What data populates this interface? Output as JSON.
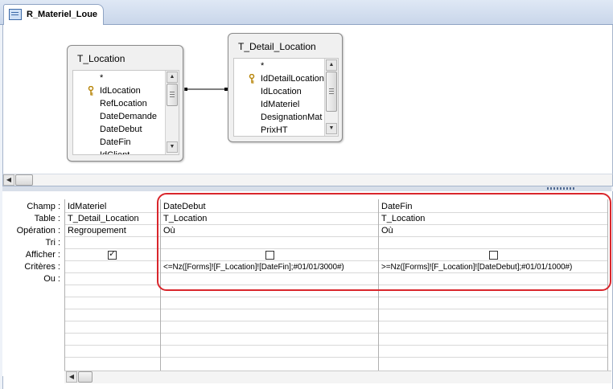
{
  "tab": {
    "label": "R_Materiel_Loue",
    "icon": "query-icon"
  },
  "tables": [
    {
      "title": "T_Location",
      "fields": [
        {
          "name": "*",
          "key": false
        },
        {
          "name": "IdLocation",
          "key": true
        },
        {
          "name": "RefLocation",
          "key": false
        },
        {
          "name": "DateDemande",
          "key": false
        },
        {
          "name": "DateDebut",
          "key": false
        },
        {
          "name": "DateFin",
          "key": false
        },
        {
          "name": "IdClient",
          "key": false
        }
      ]
    },
    {
      "title": "T_Detail_Location",
      "fields": [
        {
          "name": "*",
          "key": false
        },
        {
          "name": "IdDetailLocation",
          "key": true
        },
        {
          "name": "IdLocation",
          "key": false
        },
        {
          "name": "IdMateriel",
          "key": false
        },
        {
          "name": "DesignationMat",
          "key": false
        },
        {
          "name": "PrixHT",
          "key": false
        }
      ]
    }
  ],
  "grid": {
    "row_labels": [
      "Champ :",
      "Table :",
      "Opération :",
      "Tri :",
      "Afficher :",
      "Critères :",
      "Ou :"
    ],
    "columns": [
      {
        "champ": "IdMateriel",
        "table": "T_Detail_Location",
        "operation": "Regroupement",
        "tri": "",
        "afficher": true,
        "criteres": "",
        "ou": ""
      },
      {
        "champ": "DateDebut",
        "table": "T_Location",
        "operation": "Où",
        "tri": "",
        "afficher": false,
        "criteres": "<=Nz([Forms]![F_Location]![DateFin];#01/01/3000#)",
        "ou": ""
      },
      {
        "champ": "DateFin",
        "table": "T_Location",
        "operation": "Où",
        "tri": "",
        "afficher": false,
        "criteres": ">=Nz([Forms]![F_Location]![DateDebut];#01/01/1000#)",
        "ou": ""
      }
    ]
  },
  "colors": {
    "highlight": "#d9262c",
    "chrome": "#c9d6ea",
    "key": "#d4a017"
  }
}
